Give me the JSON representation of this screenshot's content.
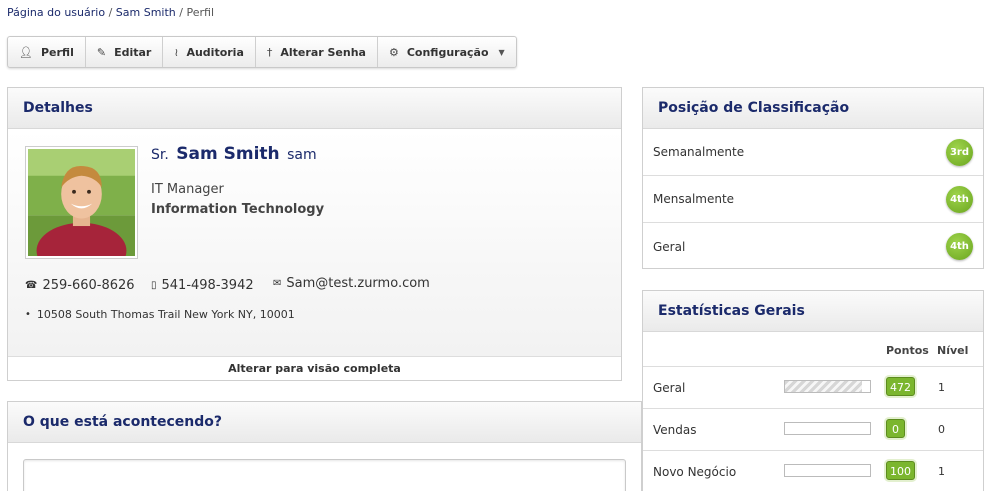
{
  "breadcrumb": {
    "items": [
      "Página do usuário",
      "Sam Smith",
      "Perfil"
    ],
    "separator": "/"
  },
  "toolbar": {
    "buttons": [
      {
        "label": "Perfil",
        "icon": "user-icon"
      },
      {
        "label": "Editar",
        "icon": "pencil-icon"
      },
      {
        "label": "Auditoria",
        "icon": "activity-icon"
      },
      {
        "label": "Alterar Senha",
        "icon": "key-icon"
      },
      {
        "label": "Configuração",
        "icon": "gear-icon"
      }
    ]
  },
  "details": {
    "title": "Detalhes",
    "salutation": "Sr.",
    "full_name": "Sam Smith",
    "username": "sam",
    "job_title": "IT Manager",
    "department": "Information Technology",
    "office_phone": "259-660-8626",
    "mobile_phone": "541-498-3942",
    "email": "Sam@test.zurmo.com",
    "address": "10508 South Thomas Trail New York NY, 10001",
    "toggle_label": "Alterar para visão completa"
  },
  "happening": {
    "title": "O que está acontecendo?"
  },
  "ranking": {
    "title": "Posição de Classificação",
    "rows": [
      {
        "label": "Semanalmente",
        "rank": "3rd"
      },
      {
        "label": "Mensalmente",
        "rank": "4th"
      },
      {
        "label": "Geral",
        "rank": "4th"
      }
    ]
  },
  "stats": {
    "title": "Estatísticas Gerais",
    "col_points": "Pontos",
    "col_level": "Nível",
    "rows": [
      {
        "label": "Geral",
        "progress": 0.9,
        "points": "472",
        "level": "1"
      },
      {
        "label": "Vendas",
        "progress": 0,
        "points": "0",
        "level": "0"
      },
      {
        "label": "Novo Negócio",
        "progress": 0,
        "points": "100",
        "level": "1"
      }
    ]
  },
  "colors": {
    "accent": "#1b2a6b",
    "badge_green": "#7bb62e"
  }
}
